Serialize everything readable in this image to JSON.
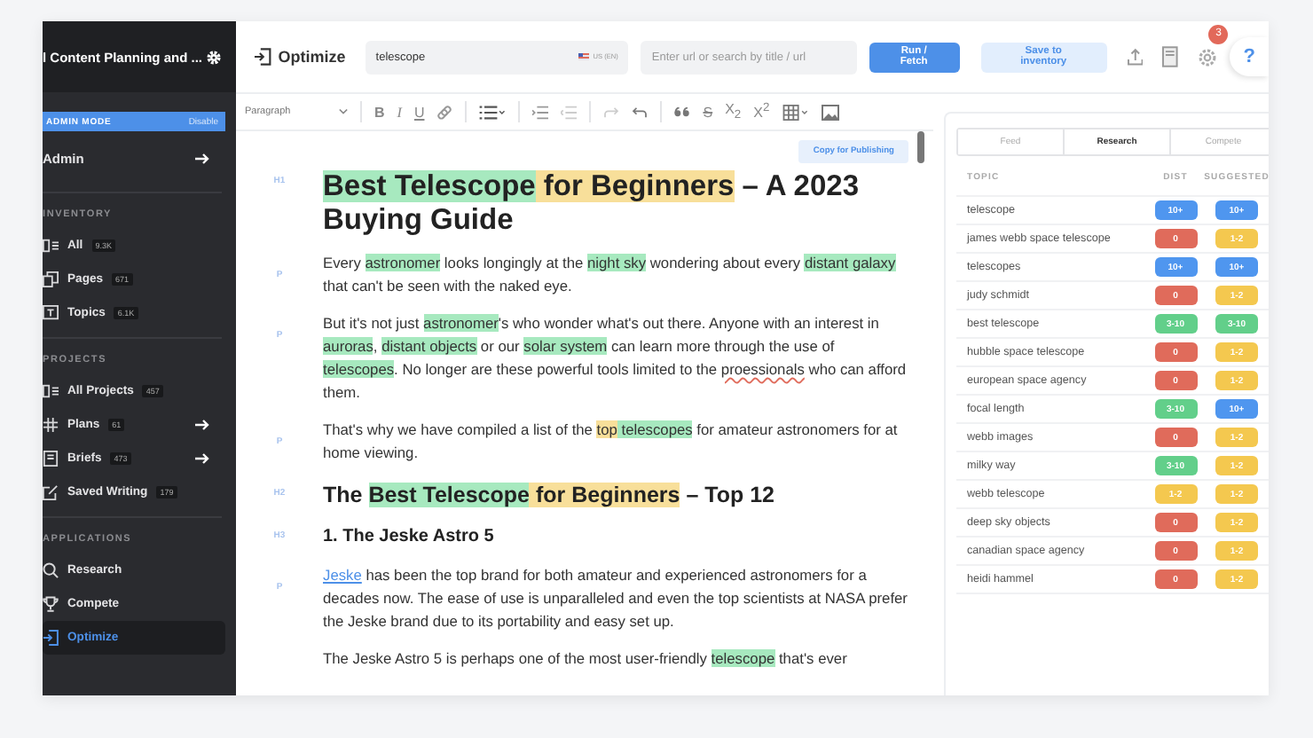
{
  "sidebar": {
    "title": "l Content Planning and ...",
    "admin_mode": {
      "label": "ADMIN MODE",
      "action": "Disable"
    },
    "admin": {
      "label": "Admin"
    },
    "sections": [
      {
        "heading": "INVENTORY",
        "items": [
          {
            "label": "All",
            "count": "9.3K",
            "arrow": false,
            "selected": false
          },
          {
            "label": "Pages",
            "count": "671",
            "arrow": false,
            "selected": false
          },
          {
            "label": "Topics",
            "count": "6.1K",
            "arrow": false,
            "selected": false
          }
        ]
      },
      {
        "heading": "PROJECTS",
        "items": [
          {
            "label": "All Projects",
            "count": "457",
            "arrow": false,
            "selected": false
          },
          {
            "label": "Plans",
            "count": "61",
            "arrow": true,
            "selected": false
          },
          {
            "label": "Briefs",
            "count": "473",
            "arrow": true,
            "selected": false
          },
          {
            "label": "Saved Writing",
            "count": "179",
            "arrow": false,
            "selected": false
          }
        ]
      },
      {
        "heading": "APPLICATIONS",
        "items": [
          {
            "label": "Research",
            "arrow": false,
            "selected": false
          },
          {
            "label": "Compete",
            "arrow": false,
            "selected": false
          },
          {
            "label": "Optimize",
            "arrow": false,
            "selected": true
          }
        ]
      }
    ]
  },
  "header": {
    "title": "Optimize",
    "keyword": "telescope",
    "locale": "US (EN)",
    "url_placeholder": "Enter url or search by title / url",
    "run_button": "Run / Fetch",
    "save_button": "Save to inventory",
    "notification_count": "3",
    "help": "?"
  },
  "toolbar": {
    "style": "Paragraph",
    "format": [
      "B",
      "I",
      "U"
    ],
    "strike": "S",
    "scripts": [
      "X$_{2}$",
      "X$^{2}$"
    ]
  },
  "copy_button": "Copy for Publishing",
  "document": [
    {
      "kind": "h1",
      "tag": "H1",
      "segments": [
        {
          "text": "Best Telescope",
          "color": "#a7e9bf"
        },
        {
          "text": " for Beginners",
          "color": "#f8df9a"
        },
        {
          "text": " – A 2023 Buying Guide"
        }
      ]
    },
    {
      "kind": "p",
      "tag": "P",
      "segments": [
        {
          "text": "Every "
        },
        {
          "text": "astronomer",
          "color": "#a7e9bf"
        },
        {
          "text": " looks longingly at the "
        },
        {
          "text": "night sky",
          "color": "#a7e9bf"
        },
        {
          "text": " wondering about every "
        },
        {
          "text": "distant galaxy",
          "color": "#a7e9bf"
        },
        {
          "text": " that can't be seen with the naked eye."
        }
      ]
    },
    {
      "kind": "p",
      "tag": "P",
      "segments": [
        {
          "text": "But it's not just "
        },
        {
          "text": "astronomer",
          "color": "#a7e9bf"
        },
        {
          "text": "'s who wonder what's out there. Anyone with an interest in "
        },
        {
          "text": "auroras",
          "color": "#a7e9bf"
        },
        {
          "text": ", "
        },
        {
          "text": "distant objects",
          "color": "#a7e9bf"
        },
        {
          "text": " or our "
        },
        {
          "text": "solar system",
          "color": "#a7e9bf"
        },
        {
          "text": " can learn more through the use of "
        },
        {
          "text": "telescopes",
          "color": "#a7e9bf"
        },
        {
          "text": ". No longer are these powerful tools limited to the "
        },
        {
          "text": "proessionals",
          "kind": "misspelled"
        },
        {
          "text": " who can afford them."
        }
      ]
    },
    {
      "kind": "p",
      "tag": "P",
      "segments": [
        {
          "text": "That's why we have compiled a list of the "
        },
        {
          "text": "top",
          "color": "#f8df9a"
        },
        {
          "text": " telescopes",
          "color": "#a7e9bf"
        },
        {
          "text": " for amateur astronomers for at home viewing."
        }
      ]
    },
    {
      "kind": "h2",
      "tag": "H2",
      "segments": [
        {
          "text": "The "
        },
        {
          "text": "Best Telescope",
          "color": "#a7e9bf"
        },
        {
          "text": " for Beginners",
          "color": "#f8df9a"
        },
        {
          "text": " – Top 12"
        }
      ]
    },
    {
      "kind": "h3",
      "tag": "H3",
      "segments": [
        {
          "text": "1. The Jeske Astro 5"
        }
      ]
    },
    {
      "kind": "p",
      "tag": "P",
      "segments": [
        {
          "text": "Jeske",
          "kind": "link"
        },
        {
          "text": " has been the top brand for both amateur and experienced astronomers for a decades now. The ease of use is unparalleled and even the top scientists at NASA prefer the Jeske brand due to its portability and easy set up."
        }
      ]
    },
    {
      "kind": "p",
      "segments": [
        {
          "text": "The Jeske Astro 5 is perhaps one of the most user-friendly "
        },
        {
          "text": "telescope",
          "color": "#a7e9bf"
        },
        {
          "text": " that's ever"
        }
      ]
    }
  ],
  "panel": {
    "tabs": [
      {
        "label": "Feed",
        "selected": false
      },
      {
        "label": "Research",
        "selected": true
      },
      {
        "label": "Compete",
        "selected": false
      }
    ],
    "columns": [
      "TOPIC",
      "DIST",
      "SUGGESTED"
    ],
    "rows": [
      {
        "topic": "telescope",
        "dist": {
          "label": "10+",
          "color": "#4f96ef"
        },
        "suggested": {
          "label": "10+",
          "color": "#4f96ef"
        }
      },
      {
        "topic": "james webb space telescope",
        "dist": {
          "label": "0",
          "color": "#e06b5b"
        },
        "suggested": {
          "label": "1-2",
          "color": "#f4c84f"
        }
      },
      {
        "topic": "telescopes",
        "dist": {
          "label": "10+",
          "color": "#4f96ef"
        },
        "suggested": {
          "label": "10+",
          "color": "#4f96ef"
        }
      },
      {
        "topic": "judy schmidt",
        "dist": {
          "label": "0",
          "color": "#e06b5b"
        },
        "suggested": {
          "label": "1-2",
          "color": "#f4c84f"
        }
      },
      {
        "topic": "best telescope",
        "dist": {
          "label": "3-10",
          "color": "#62cf8a"
        },
        "suggested": {
          "label": "3-10",
          "color": "#62cf8a"
        }
      },
      {
        "topic": "hubble space telescope",
        "dist": {
          "label": "0",
          "color": "#e06b5b"
        },
        "suggested": {
          "label": "1-2",
          "color": "#f4c84f"
        }
      },
      {
        "topic": "european space agency",
        "dist": {
          "label": "0",
          "color": "#e06b5b"
        },
        "suggested": {
          "label": "1-2",
          "color": "#f4c84f"
        }
      },
      {
        "topic": "focal length",
        "dist": {
          "label": "3-10",
          "color": "#62cf8a"
        },
        "suggested": {
          "label": "10+",
          "color": "#4f96ef"
        }
      },
      {
        "topic": "webb images",
        "dist": {
          "label": "0",
          "color": "#e06b5b"
        },
        "suggested": {
          "label": "1-2",
          "color": "#f4c84f"
        }
      },
      {
        "topic": "milky way",
        "dist": {
          "label": "3-10",
          "color": "#62cf8a"
        },
        "suggested": {
          "label": "1-2",
          "color": "#f4c84f"
        }
      },
      {
        "topic": "webb telescope",
        "dist": {
          "label": "1-2",
          "color": "#f4c84f"
        },
        "suggested": {
          "label": "1-2",
          "color": "#f4c84f"
        }
      },
      {
        "topic": "deep sky objects",
        "dist": {
          "label": "0",
          "color": "#e06b5b"
        },
        "suggested": {
          "label": "1-2",
          "color": "#f4c84f"
        }
      },
      {
        "topic": "canadian space agency",
        "dist": {
          "label": "0",
          "color": "#e06b5b"
        },
        "suggested": {
          "label": "1-2",
          "color": "#f4c84f"
        }
      },
      {
        "topic": "heidi hammel",
        "dist": {
          "label": "0",
          "color": "#e06b5b"
        },
        "suggested": {
          "label": "1-2",
          "color": "#f4c84f"
        }
      }
    ]
  }
}
